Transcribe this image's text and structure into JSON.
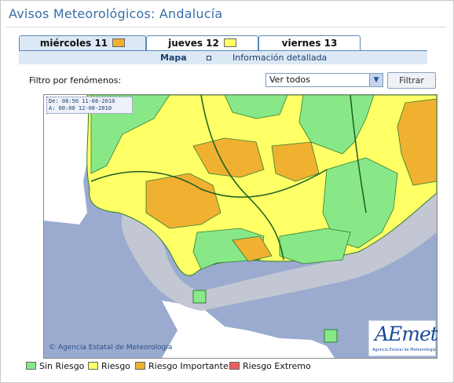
{
  "page": {
    "title": "Avisos Meteorológicos: Andalucía"
  },
  "tabs": [
    {
      "label": "miércoles 11",
      "color": "#f0b030",
      "active": true
    },
    {
      "label": "jueves 12",
      "color": "#ffff66",
      "active": false
    },
    {
      "label": "viernes 13",
      "color": null,
      "active": false
    }
  ],
  "subnav": {
    "map": "Mapa",
    "detail": "Información detallada"
  },
  "filter": {
    "label": "Filtro por fenómenos:",
    "selected": "Ver todos",
    "button": "Filtrar"
  },
  "map": {
    "date_from": "De: 08:50 11-08-2010",
    "date_to": "A:  00:00 12-08-2010",
    "copyright": "© Agencia Estatal de Meteorología",
    "logo_text": "AEmet",
    "logo_sub": "Agencia Estatal de Meteorología"
  },
  "legend": [
    {
      "label": "Sin Riesgo",
      "color": "#88e888"
    },
    {
      "label": "Riesgo",
      "color": "#ffff66"
    },
    {
      "label": "Riesgo Importante",
      "color": "#f0b030"
    },
    {
      "label": "Riesgo Extremo",
      "color": "#e86060"
    }
  ]
}
